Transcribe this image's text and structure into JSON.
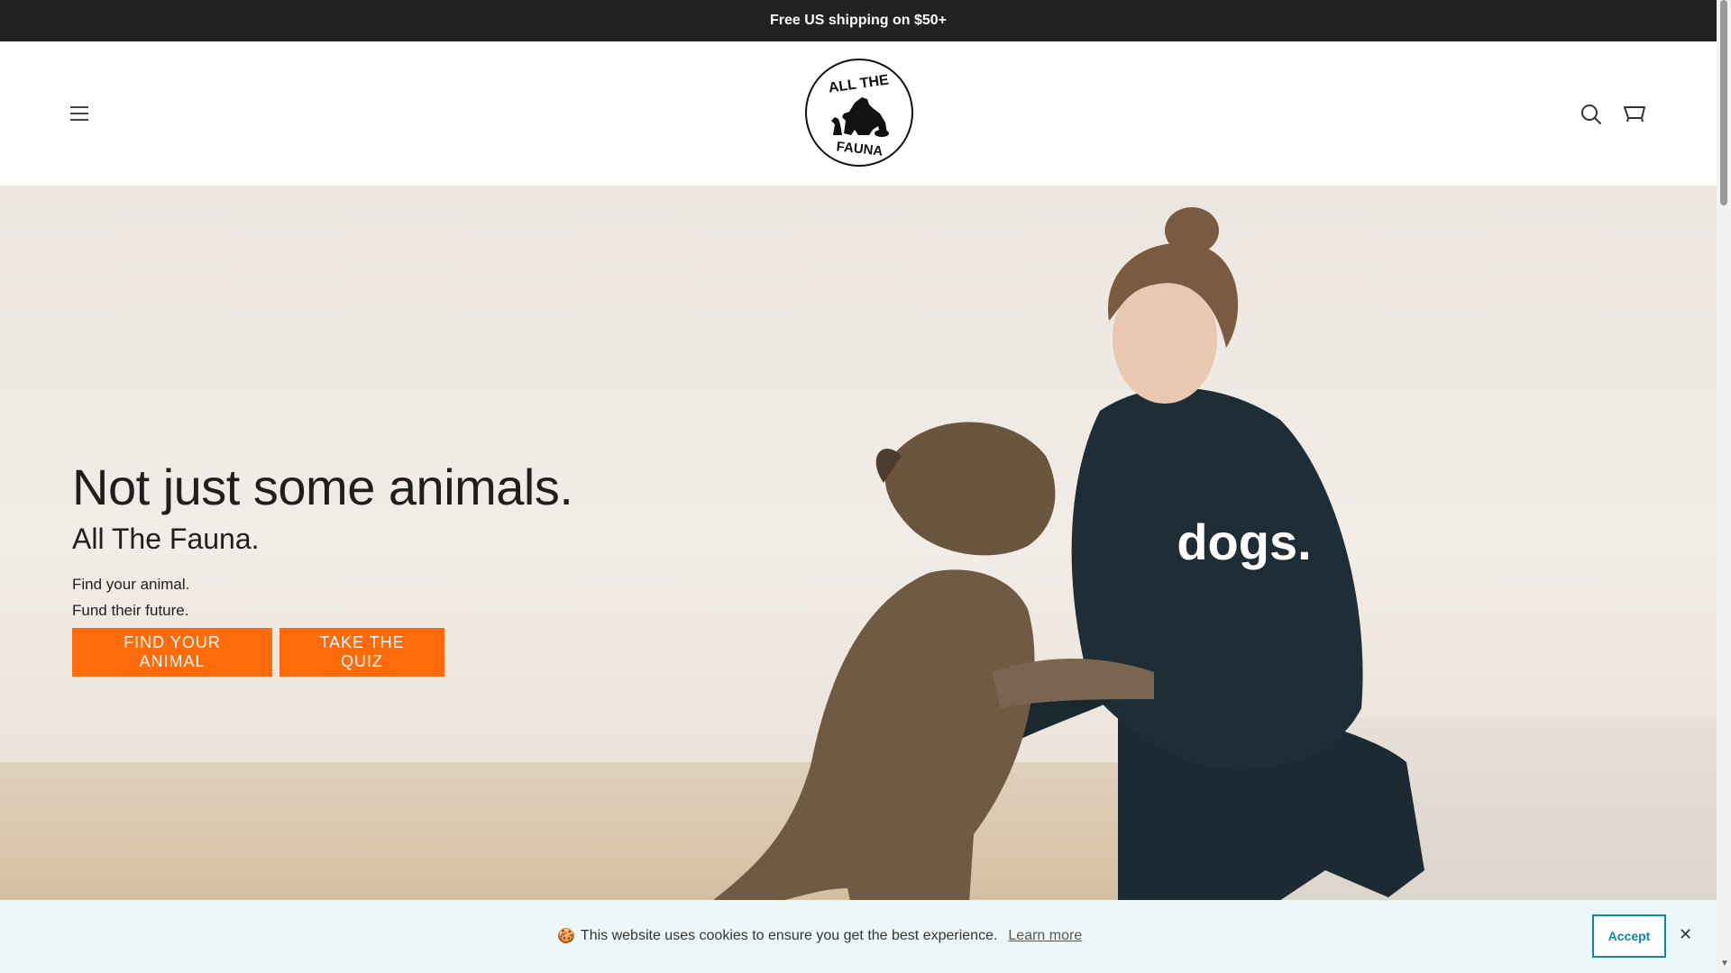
{
  "announcement": {
    "text": "Free US shipping on $50+"
  },
  "logo": {
    "top_text": "ALL THE",
    "bottom_text": "FAUNA"
  },
  "hero": {
    "headline": "Not just some animals.",
    "subheadline": "All The Fauna.",
    "tagline_line1": "Find your animal.",
    "tagline_line2": "Fund their future.",
    "cta_primary": "FIND YOUR ANIMAL",
    "cta_secondary": "TAKE THE QUIZ",
    "shirt_text": "dogs."
  },
  "cookie": {
    "emoji": "🍪",
    "message": "This website uses cookies to ensure you get the best experience.",
    "learn_more": "Learn more",
    "accept": "Accept",
    "close": "✕"
  },
  "colors": {
    "announce_bg": "#222222",
    "cta": "#ff6b0b",
    "cookie_bg": "#ecf8f8",
    "accept_border": "#0b8aa0"
  },
  "icons": {
    "menu": "hamburger-menu-icon",
    "search": "search-icon",
    "cart": "cart-icon",
    "close": "close-icon"
  }
}
